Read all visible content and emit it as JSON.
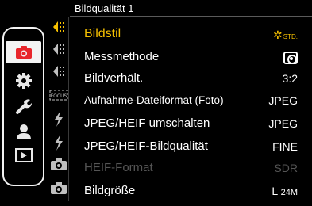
{
  "header": {
    "title": "Bildqualität 1"
  },
  "categories": [
    {
      "id": "photo",
      "icon": "camera-icon",
      "active": true
    },
    {
      "id": "custom",
      "icon": "gear-icon",
      "active": false
    },
    {
      "id": "setup",
      "icon": "wrench-icon",
      "active": false
    },
    {
      "id": "mymenu",
      "icon": "person-icon",
      "active": false
    },
    {
      "id": "playback",
      "icon": "play-icon",
      "active": false
    }
  ],
  "menu": {
    "items": [
      {
        "label": "Bildstil",
        "value_text": "STD.",
        "value_icon": "photo-style-icon",
        "selected": true
      },
      {
        "label": "Messmethode",
        "value_icon": "metering-icon"
      },
      {
        "label": "Bildverhält.",
        "value": "3:2"
      },
      {
        "label": "Aufnahme-Dateiformat (Foto)",
        "value": "JPEG"
      },
      {
        "label": "JPEG/HEIF umschalten",
        "value": "JPEG"
      },
      {
        "label": "JPEG/HEIF-Bildqualität",
        "value": "FINE"
      },
      {
        "label": "HEIF-Format",
        "value": "SDR",
        "disabled": true
      },
      {
        "label": "Bildgröße",
        "value_main": "L",
        "value_sub": "24M"
      }
    ]
  },
  "colors": {
    "accent": "#f6c000",
    "disabled": "#555555",
    "active_category_icon": "#e8262b"
  }
}
